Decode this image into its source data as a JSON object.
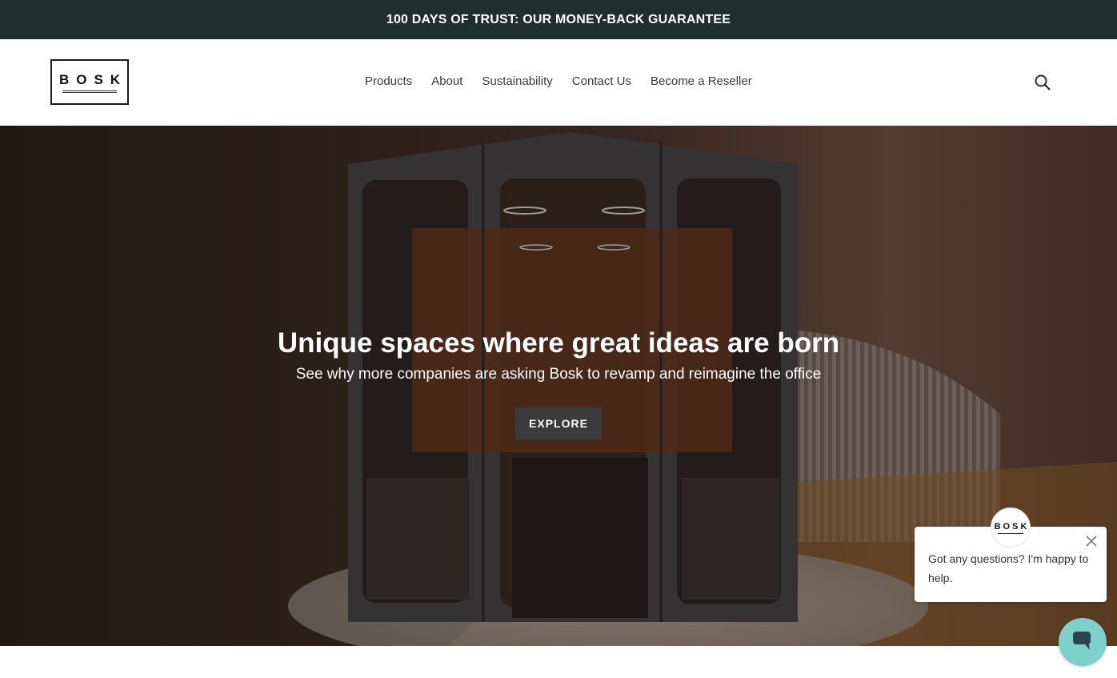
{
  "announcement": {
    "text": "100 DAYS OF TRUST: OUR MONEY-BACK GUARANTEE"
  },
  "header": {
    "logo_text": "BOSK",
    "nav": [
      {
        "label": "Products"
      },
      {
        "label": "About"
      },
      {
        "label": "Sustainability"
      },
      {
        "label": "Contact Us"
      },
      {
        "label": "Become a Reseller"
      }
    ],
    "search_icon": "search-icon"
  },
  "hero": {
    "title": "Unique spaces where great ideas are born",
    "subtitle": "See why more companies are asking Bosk to revamp and reimagine the office",
    "button_label": "EXPLORE"
  },
  "chat": {
    "avatar_text": "BOSK",
    "message": "Got any questions? I'm happy to help.",
    "close_icon": "close-icon",
    "launcher_icon": "chat-bubble-icon",
    "launcher_color": "#7ed0cb"
  },
  "colors": {
    "announcement_bg": "#1f2f2d",
    "button_bg": "#3b3b3b"
  }
}
